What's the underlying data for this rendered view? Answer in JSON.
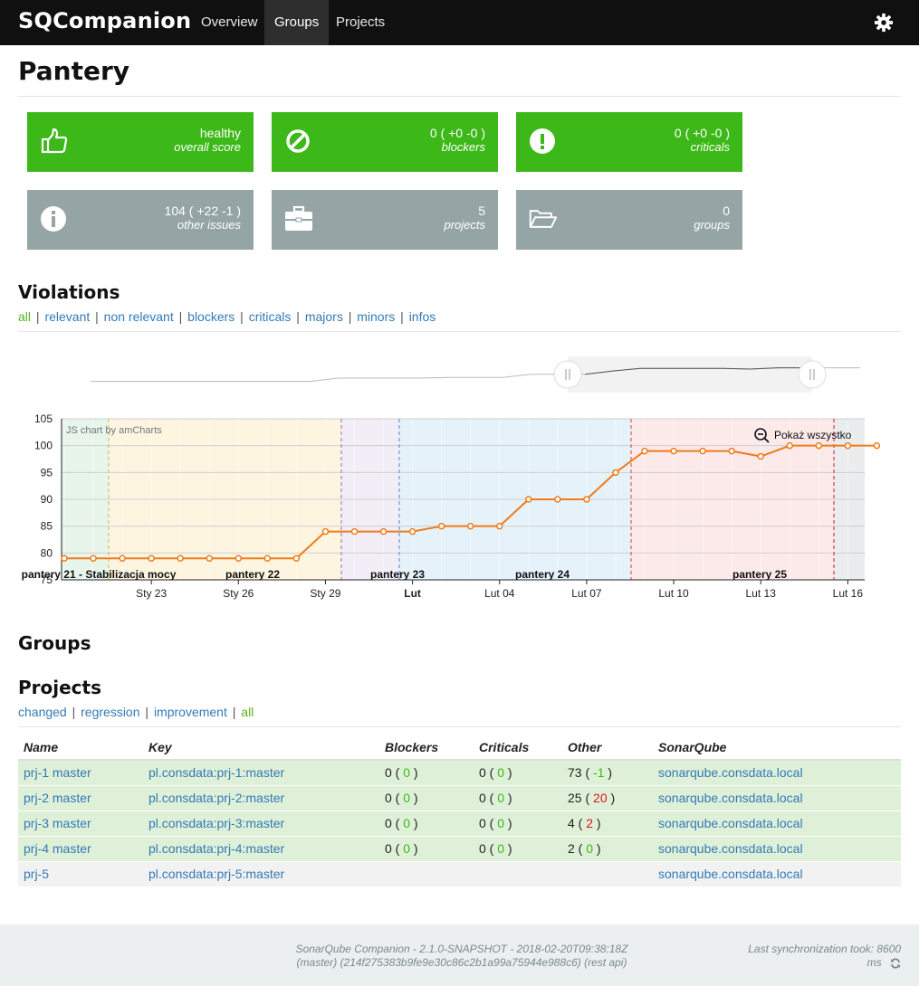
{
  "nav": {
    "brand": "SQCompanion",
    "items": [
      "Overview",
      "Groups",
      "Projects"
    ],
    "active": "Groups"
  },
  "page": {
    "title": "Pantery"
  },
  "tiles": [
    {
      "value": "healthy",
      "label": "overall score",
      "color": "#3cb818",
      "icon": "thumbs-up-icon"
    },
    {
      "value": "0 ( +0 -0 )",
      "label": "blockers",
      "color": "#3cb818",
      "icon": "ban-icon"
    },
    {
      "value": "0 ( +0 -0 )",
      "label": "criticals",
      "color": "#3cb818",
      "icon": "exclamation-icon"
    },
    {
      "value": "104 ( +22 -1 )",
      "label": "other issues",
      "color": "#95a5a5",
      "icon": "info-icon"
    },
    {
      "value": "5",
      "label": "projects",
      "color": "#95a5a5",
      "icon": "briefcase-icon"
    },
    {
      "value": "0",
      "label": "groups",
      "color": "#95a5a5",
      "icon": "folder-open-icon"
    }
  ],
  "violations": {
    "title": "Violations",
    "filters": [
      "all",
      "relevant",
      "non relevant",
      "blockers",
      "criticals",
      "majors",
      "minors",
      "infos"
    ],
    "active_filter": "all"
  },
  "chart_data": {
    "type": "line",
    "credit": "JS chart by amCharts",
    "zoom_label": "Pokaż wszystko",
    "ylim": [
      75,
      105
    ],
    "yticks": [
      75,
      80,
      85,
      90,
      95,
      100,
      105
    ],
    "x_ticks": [
      "Sty 23",
      "Sty 26",
      "Sty 29",
      "Lut",
      "Lut 04",
      "Lut 07",
      "Lut 10",
      "Lut 13",
      "Lut 16"
    ],
    "x": [
      "Sty 20",
      "Sty 21",
      "Sty 22",
      "Sty 23",
      "Sty 24",
      "Sty 25",
      "Sty 26",
      "Sty 27",
      "Sty 28",
      "Sty 29",
      "Sty 30",
      "Sty 31",
      "Lut 01",
      "Lut 02",
      "Lut 03",
      "Lut 04",
      "Lut 05",
      "Lut 06",
      "Lut 07",
      "Lut 08",
      "Lut 09",
      "Lut 10",
      "Lut 11",
      "Lut 12",
      "Lut 13",
      "Lut 14",
      "Lut 15",
      "Lut 16",
      "Lut 17"
    ],
    "series": [
      {
        "values": [
          79,
          79,
          79,
          79,
          79,
          79,
          79,
          79,
          79,
          84,
          84,
          84,
          84,
          85,
          85,
          85,
          90,
          90,
          90,
          95,
          99,
          99,
          99,
          99,
          98,
          100,
          100,
          100,
          100
        ],
        "color": "#f07b1a"
      }
    ],
    "sprints": [
      {
        "label": "pantery 21 - Stabilizacja mocy",
        "color": "#e8f5ea"
      },
      {
        "label": "",
        "color": "#fdf5e0"
      },
      {
        "label": "pantery 22",
        "color": "#fdf5e0"
      },
      {
        "label": "pantery 23",
        "color": "#f2edf6"
      },
      {
        "label": "pantery 24",
        "color": "#e6f2fa"
      },
      {
        "label": "pantery 25",
        "color": "#fce9ea"
      },
      {
        "label": "",
        "color": "#ebecee"
      }
    ]
  },
  "groups": {
    "title": "Groups"
  },
  "projects": {
    "title": "Projects",
    "filters": [
      "changed",
      "regression",
      "improvement",
      "all"
    ],
    "active_filter": "all",
    "columns": [
      "Name",
      "Key",
      "Blockers",
      "Criticals",
      "Other",
      "SonarQube"
    ],
    "rows": [
      {
        "name": "prj-1 master",
        "key": "pl.consdata:prj-1:master",
        "blockers": "0",
        "blockers_delta": "0",
        "criticals": "0",
        "criticals_delta": "0",
        "other": "73",
        "other_delta": "-1",
        "other_delta_color": "#3cb818",
        "sonar": "sonarqube.consdata.local"
      },
      {
        "name": "prj-2 master",
        "key": "pl.consdata:prj-2:master",
        "blockers": "0",
        "blockers_delta": "0",
        "criticals": "0",
        "criticals_delta": "0",
        "other": "25",
        "other_delta": "20",
        "other_delta_color": "#e0141e",
        "sonar": "sonarqube.consdata.local"
      },
      {
        "name": "prj-3 master",
        "key": "pl.consdata:prj-3:master",
        "blockers": "0",
        "blockers_delta": "0",
        "criticals": "0",
        "criticals_delta": "0",
        "other": "4",
        "other_delta": "2",
        "other_delta_color": "#e0141e",
        "sonar": "sonarqube.consdata.local"
      },
      {
        "name": "prj-4 master",
        "key": "pl.consdata:prj-4:master",
        "blockers": "0",
        "blockers_delta": "0",
        "criticals": "0",
        "criticals_delta": "0",
        "other": "2",
        "other_delta": "0",
        "other_delta_color": "#3cb818",
        "sonar": "sonarqube.consdata.local"
      },
      {
        "name": "prj-5",
        "key": "pl.consdata:prj-5:master",
        "sonar": "sonarqube.consdata.local"
      }
    ]
  },
  "footer": {
    "version": "SonarQube Companion - 2.1.0-SNAPSHOT - 2018-02-20T09:38:18Z",
    "build": "(master) (214f275383b9fe9e30c86c2b1a99a75944e988c6) (rest api)",
    "sync_line1": "Last synchronization took: 8600",
    "sync_line2": "ms"
  }
}
